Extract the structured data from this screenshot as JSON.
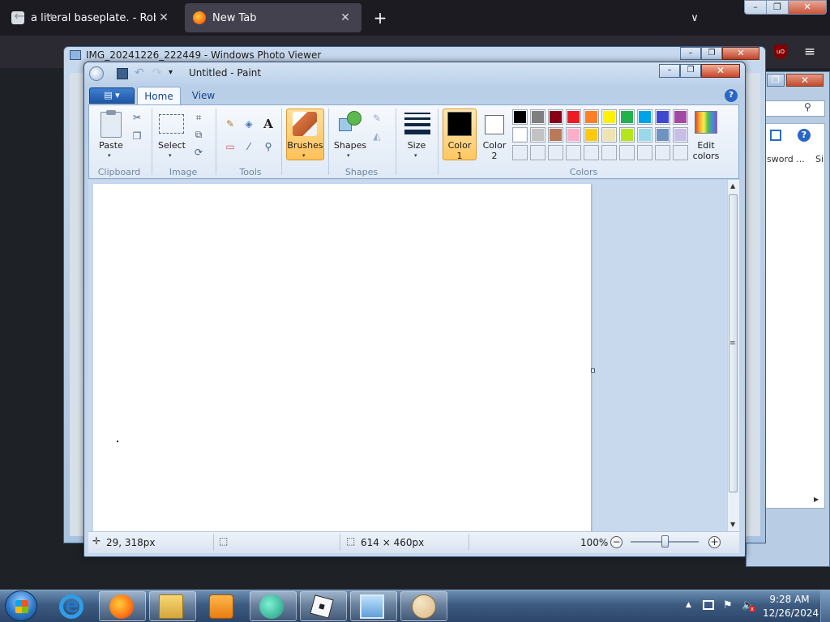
{
  "browser": {
    "tabs": [
      {
        "title": "a literal baseplate. - Roblox",
        "close": "✕"
      },
      {
        "title": "New Tab",
        "close": "✕"
      }
    ],
    "new_tab_symbol": "+",
    "list_tabs_symbol": "∨",
    "back_symbol": "←",
    "forward_symbol": "→",
    "menu_symbol": "≡",
    "ublock_text": "uO",
    "window_controls": {
      "minimize": "–",
      "maximize": "❐",
      "close": "✕"
    }
  },
  "background_window": {
    "password_text": "sword ...",
    "partial_text": "Si",
    "help_symbol": "?",
    "search_symbol": "⚲",
    "maximize": "❐",
    "close": "✕",
    "scroll_arrow": "▶"
  },
  "photo_viewer": {
    "title": "IMG_20241226_222449 - Windows Photo Viewer",
    "controls": {
      "minimize": "–",
      "maximize": "❐",
      "close": "✕"
    }
  },
  "paint": {
    "title": "Untitled - Paint",
    "qat": {
      "undo": "↶",
      "redo": "↷",
      "dropdown": "▾"
    },
    "controls": {
      "minimize": "–",
      "maximize": "❐",
      "close": "✕"
    },
    "tabs": {
      "app_menu": "▤ ▾",
      "home": "Home",
      "view": "View"
    },
    "help_symbol": "?",
    "ribbon": {
      "paste": "Paste",
      "select": "Select",
      "brushes": "Brushes",
      "shapes": "Shapes",
      "size": "Size",
      "color1": "Color\n1",
      "color1_line1": "Color",
      "color1_line2": "1",
      "color2_line1": "Color",
      "color2_line2": "2",
      "edit_colors_line1": "Edit",
      "edit_colors_line2": "colors",
      "groups": {
        "clipboard": "Clipboard",
        "image": "Image",
        "tools": "Tools",
        "shapes": "Shapes",
        "colors": "Colors"
      },
      "tool_icons": {
        "cut": "✂",
        "copy": "❐",
        "crop": "⌗",
        "resize": "⧉",
        "rotate": "⟳",
        "pencil": "✎",
        "fill": "◈",
        "text": "A",
        "eraser": "▭",
        "picker": "⁄",
        "magnifier": "⚲",
        "outline": "✎",
        "fill_shape": "◭"
      },
      "caret": "▾"
    },
    "palette": {
      "row1": [
        "#000000",
        "#7f7f7f",
        "#880015",
        "#ed1c24",
        "#ff7f27",
        "#fff200",
        "#22b14c",
        "#00a2e8",
        "#3f48cc",
        "#a349a4"
      ],
      "row2": [
        "#ffffff",
        "#c3c3c3",
        "#b97a57",
        "#ffaec9",
        "#ffc90e",
        "#efe4b0",
        "#b5e61d",
        "#99d9ea",
        "#7092be",
        "#c8bfe7"
      ],
      "row3": [
        "",
        "",
        "",
        "",
        "",
        "",
        "",
        "",
        "",
        ""
      ]
    },
    "color1": "#000000",
    "color2": "#ffffff",
    "scroll": {
      "up": "▲",
      "down": "▼",
      "grip": "≡"
    },
    "status": {
      "position_icon": "✛",
      "position": "29, 318px",
      "selection_icon": "⬚",
      "size_icon": "⬚",
      "canvas_size": "614 × 460px",
      "zoom": "100%",
      "zoom_minus": "−",
      "zoom_plus": "+",
      "zoom_level": 0.5
    }
  },
  "taskbar": {
    "clock_time": "9:28 AM",
    "clock_date": "12/26/2024",
    "tray_up": "▲",
    "tray_flag": "⚑",
    "tray_volume": "🔈",
    "tray_volume_muted": "x"
  }
}
